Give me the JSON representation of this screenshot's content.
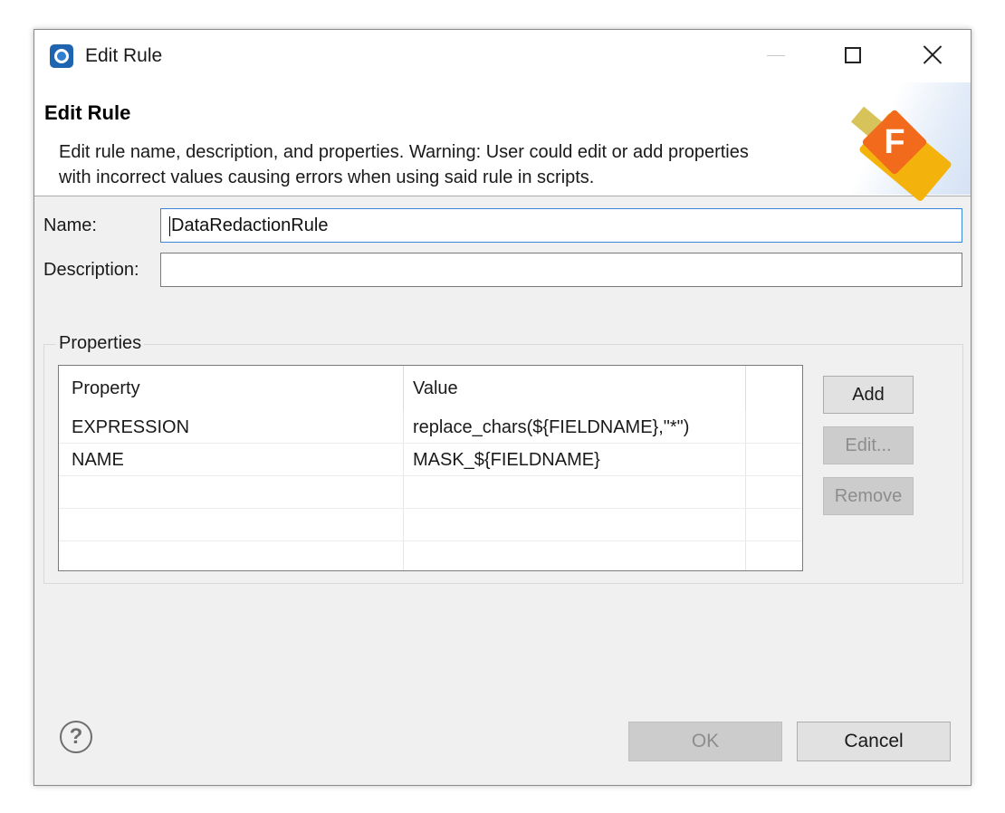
{
  "window": {
    "title": "Edit Rule",
    "app_icon": "eclipse-app-icon"
  },
  "banner": {
    "title": "Edit Rule",
    "description_line1": "Edit rule name, description, and properties. Warning: User could edit or add properties",
    "description_line2": "with incorrect values causing errors when using said rule in scripts.",
    "badge_letter": "F"
  },
  "form": {
    "name_label": "Name:",
    "name_value": "DataRedactionRule",
    "description_label": "Description:",
    "description_value": ""
  },
  "properties": {
    "group_title": "Properties",
    "columns": [
      "Property",
      "Value"
    ],
    "rows": [
      {
        "property": "EXPRESSION",
        "value": "replace_chars(${FIELDNAME},\"*\")"
      },
      {
        "property": "NAME",
        "value": "MASK_${FIELDNAME}"
      },
      {
        "property": "",
        "value": ""
      },
      {
        "property": "",
        "value": ""
      },
      {
        "property": "",
        "value": ""
      }
    ],
    "buttons": {
      "add": "Add",
      "edit": "Edit...",
      "remove": "Remove"
    }
  },
  "footer": {
    "help_glyph": "?",
    "ok_label": "OK",
    "cancel_label": "Cancel"
  },
  "colors": {
    "focus_border": "#3b86d8",
    "badge_orange": "#f26a1b",
    "usb_yellow": "#f4b30c"
  }
}
